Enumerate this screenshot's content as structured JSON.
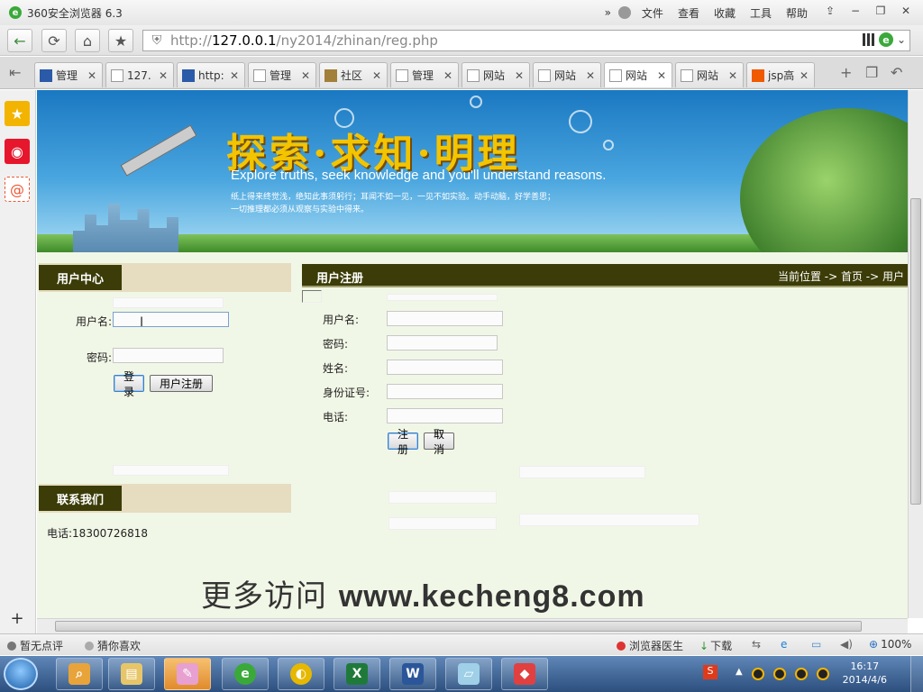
{
  "window": {
    "title": "360安全浏览器 6.3",
    "menu": [
      "文件",
      "查看",
      "收藏",
      "工具",
      "帮助"
    ],
    "buttons": {
      "pin": "⇪",
      "minimize": "−",
      "restore": "❐",
      "close": "✕"
    }
  },
  "address": {
    "scheme": "http://",
    "host": "127.0.0.1",
    "path": "/ny2014/zhinan/reg.php"
  },
  "tabs": [
    {
      "label": "管理",
      "icon": "g",
      "active": false
    },
    {
      "label": "127.",
      "icon": "page",
      "active": false
    },
    {
      "label": "http:",
      "icon": "g",
      "active": false
    },
    {
      "label": "管理",
      "icon": "page",
      "active": false
    },
    {
      "label": "社区",
      "icon": "s",
      "active": false
    },
    {
      "label": "管理",
      "icon": "page",
      "active": false
    },
    {
      "label": "网站",
      "icon": "page",
      "active": false
    },
    {
      "label": "网站",
      "icon": "page",
      "active": false
    },
    {
      "label": "网站",
      "icon": "page",
      "active": true
    },
    {
      "label": "网站",
      "icon": "page",
      "active": false
    },
    {
      "label": "jsp高",
      "icon": "t",
      "active": false
    }
  ],
  "banner": {
    "title": "探索·求知·明理",
    "subtitle": "Explore truths, seek knowledge and you'll understand reasons.",
    "line1": "纸上得来终觉浅，绝知此事须躬行；耳闻不如一见，一见不如实验。动手动脑，好学善思；",
    "line2": "一切推理都必须从观察与实验中得来。"
  },
  "user_center": {
    "heading": "用户中心",
    "username_label": "用户名:",
    "password_label": "密码:",
    "login_button": "登录",
    "register_button": "用户注册"
  },
  "contact": {
    "heading": "联系我们",
    "phone": "电话:18300726818"
  },
  "register": {
    "heading": "用户注册",
    "breadcrumb": "当前位置 -> 首页 -> 用户",
    "fields": {
      "username": "用户名:",
      "password": "密码:",
      "realname": "姓名:",
      "idcard": "身份证号:",
      "phone": "电话:"
    },
    "submit_button": "注册",
    "cancel_button": "取消"
  },
  "watermark": {
    "cn": "更多访问",
    "url": "www.kecheng8.com"
  },
  "statusbar": {
    "rating": "暂无点评",
    "guess": "猜你喜欢",
    "doctor": "浏览器医生",
    "download": "下载",
    "zoom": "100%"
  },
  "clock": {
    "time": "16:17",
    "date": "2014/4/6"
  },
  "taskbar_apps": [
    "search",
    "explorer",
    "paint",
    "360browser",
    "player",
    "excel",
    "word",
    "notepad",
    "eraser"
  ]
}
